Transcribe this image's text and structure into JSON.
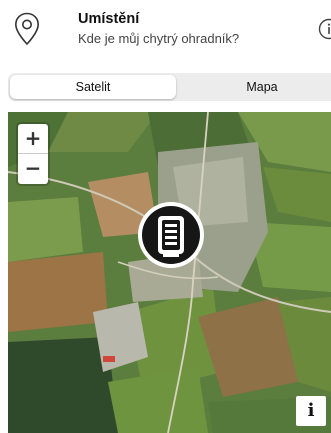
{
  "header": {
    "title": "Umístění",
    "subtitle": "Kde je můj chytrý ohradník?",
    "icon": "location-pin-icon",
    "info_icon": "info-icon"
  },
  "view_toggle": {
    "options": [
      "Satelit",
      "Mapa"
    ],
    "selected": "Satelit"
  },
  "map": {
    "zoom_in_label": "+",
    "zoom_out_label": "−",
    "info_label": "i",
    "marker_icon": "electric-fence-device-icon"
  }
}
